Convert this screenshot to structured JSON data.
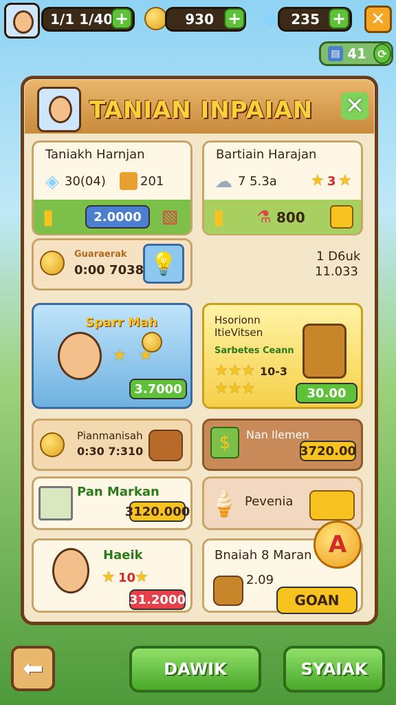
{
  "hud": {
    "level": "1/1 1/40",
    "coins": "930",
    "gems": "235",
    "tickets": "41"
  },
  "title": "TANIAN INPAIAN",
  "daily": [
    {
      "title": "Taniakh Harnjan",
      "stat1": "30(04)",
      "stat2": "201",
      "price": "2.0000"
    },
    {
      "title": "Bartiain Harajan",
      "stat1": "7 5.3a",
      "stars": "3",
      "price": "800"
    }
  ],
  "timer": {
    "label": "Guaraerak",
    "time": "0:00 7038",
    "right_title": "1 D6uk",
    "right_value": "11.033"
  },
  "featured": [
    {
      "title": "Sparr Mah",
      "price": "3.7000"
    },
    {
      "title1": "Hsorionn",
      "title2": "ItieVitsen",
      "sub": "Sarbetes Ceann",
      "count": "10-3",
      "price": "30.00"
    }
  ],
  "offers": [
    {
      "title": "Pianmanisah",
      "sub": "0:30 7:310"
    },
    {
      "title": "Nan Ilemen",
      "price": "3720.00"
    },
    {
      "title": "Pan Markan",
      "price": "3120.000"
    },
    {
      "title": "Pevenia"
    },
    {
      "title": "Haeik",
      "count": "10",
      "price": "31.2000"
    },
    {
      "title": "Bnaiah 8 Maran",
      "value": "2.09",
      "btn": "GOAN"
    }
  ],
  "footer": {
    "left": "DAWIK",
    "right": "SYAIAK"
  },
  "colors": {
    "panel_border": "#6b3d1b",
    "green": "#5fc13a",
    "gold": "#f7c320"
  }
}
